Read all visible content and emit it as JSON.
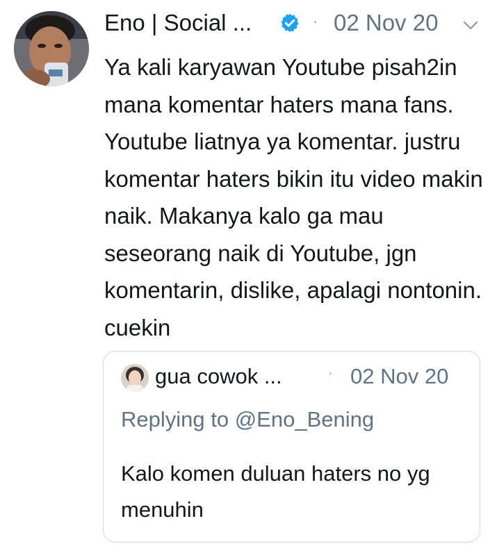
{
  "tweet": {
    "author_name": "Eno | Social ...",
    "verified_icon": "verified-badge-icon",
    "separator": "·",
    "date": "02 Nov 20",
    "menu_icon": "chevron-down-icon",
    "text": "Ya kali karyawan Youtube pisah2in mana komentar haters mana fans. Youtube liatnya ya komentar. justru komentar haters bikin itu video makin naik. Makanya kalo ga mau seseorang naik di Youtube, jgn komentarin, dislike, apalagi nontonin. cuekin"
  },
  "quoted_tweet": {
    "author_name": "gua cowok ...",
    "separator": "·",
    "date": "02 Nov 20",
    "replying_to": "Replying to @Eno_Bening",
    "text": "Kalo komen duluan haters no yg menuhin"
  },
  "colors": {
    "primary_text": "#14171a",
    "secondary_text": "#5f7384",
    "verified_blue": "#1da1f2",
    "border": "#cfd9e0"
  }
}
